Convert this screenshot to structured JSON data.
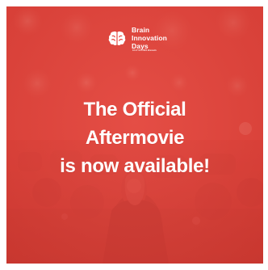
{
  "logo": {
    "line1": "Brain",
    "line2": "Innovation",
    "line3": "Days",
    "tagline": "16-17 Oct 2024 Brussels",
    "icon": "brain-icon"
  },
  "headline": {
    "line1": "The Official",
    "line2": "Aftermovie",
    "line3": "is now available!"
  },
  "colors": {
    "overlay": "#e8463f",
    "text": "#ffffff",
    "border": "#ffffff"
  }
}
